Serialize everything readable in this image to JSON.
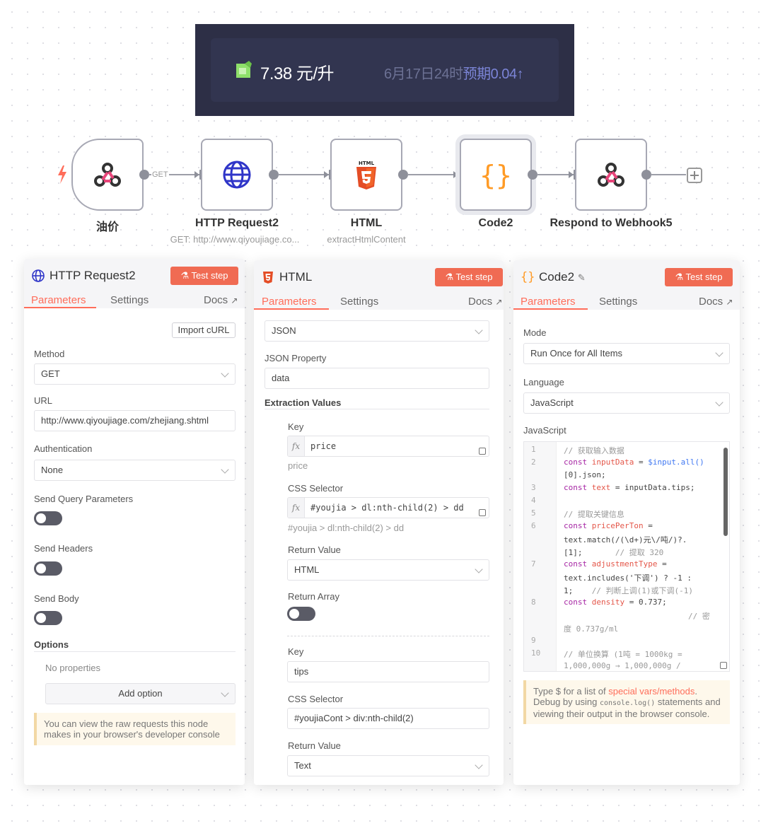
{
  "banner": {
    "price": "7.38 元/升",
    "forecast_prefix": "6月17日24时",
    "forecast_highlight": "预期0.04",
    "forecast_arrow": "↑"
  },
  "workflow": {
    "nodes": [
      {
        "label": "油价",
        "sub": ""
      },
      {
        "label": "HTTP Request2",
        "sub": "GET: http://www.qiyoujiage.co..."
      },
      {
        "label": "HTML",
        "sub": "extractHtmlContent"
      },
      {
        "label": "Code2",
        "sub": ""
      },
      {
        "label": "Respond to Webhook5",
        "sub": ""
      }
    ],
    "connection_label": "GET"
  },
  "colors": {
    "accent": "#ff6d5a",
    "banner_bg": "#2d2f46",
    "test_button": "#f06b53"
  },
  "panel_http": {
    "title": "HTTP Request2",
    "test_step": "Test step",
    "tabs": [
      "Parameters",
      "Settings"
    ],
    "docs": "Docs",
    "import_curl": "Import cURL",
    "method_label": "Method",
    "method_value": "GET",
    "url_label": "URL",
    "url_value": "http://www.qiyoujiage.com/zhejiang.shtml",
    "auth_label": "Authentication",
    "auth_value": "None",
    "send_query_label": "Send Query Parameters",
    "send_headers_label": "Send Headers",
    "send_body_label": "Send Body",
    "options_label": "Options",
    "no_properties": "No properties",
    "add_option": "Add option",
    "notice": "You can view the raw requests this node makes in your browser's developer console"
  },
  "panel_html": {
    "title": "HTML",
    "test_step": "Test step",
    "tabs": [
      "Parameters",
      "Settings"
    ],
    "docs": "Docs",
    "source_value": "JSON",
    "json_property_label": "JSON Property",
    "json_property_value": "data",
    "extraction_label": "Extraction Values",
    "item1": {
      "key_label": "Key",
      "key_value": "price",
      "key_hint": "price",
      "css_label": "CSS Selector",
      "css_value": "#youjia > dl:nth-child(2) > dd",
      "css_hint": "#youjia > dl:nth-child(2) > dd",
      "return_label": "Return Value",
      "return_value": "HTML",
      "return_array_label": "Return Array"
    },
    "item2": {
      "key_label": "Key",
      "key_value": "tips",
      "css_label": "CSS Selector",
      "css_value": "#youjiaCont > div:nth-child(2)",
      "return_label": "Return Value",
      "return_value": "Text"
    }
  },
  "panel_code": {
    "title": "Code2",
    "test_step": "Test step",
    "tabs": [
      "Parameters",
      "Settings"
    ],
    "docs": "Docs",
    "mode_label": "Mode",
    "mode_value": "Run Once for All Items",
    "language_label": "Language",
    "language_value": "JavaScript",
    "js_label": "JavaScript",
    "line_numbers": [
      "1",
      "2",
      "3",
      "4",
      "5",
      "6",
      "7",
      "8",
      "9",
      "10"
    ],
    "code": {
      "l1": "// 获取输入数据",
      "l2a_kw": "const",
      "l2a_var": "inputData",
      "l2a_rest": " = ",
      "l2a_fn": "$input.all()",
      "l2b": "[0].json;",
      "l3_kw": "const",
      "l3_var": "text",
      "l3_rest": " = inputData.tips;",
      "l5": "// 提取关键信息",
      "l6a_kw": "const",
      "l6a_var": "pricePerTon",
      "l6a_rest": " =",
      "l6b": "text.match(/(\\d+)元\\/吨/)?.",
      "l6c": "[1];",
      "l6c_cm": "// 提取 320",
      "l7a_kw": "const",
      "l7a_var": "adjustmentType",
      "l7a_rest": " =",
      "l7b": "text.includes('下调') ? -1 :",
      "l7c": "1;",
      "l7c_cm": "// 判断上调(1)或下调(-1)",
      "l8_kw": "const",
      "l8_var": "density",
      "l8_rest": " = 0.737;",
      "l8b_cm": "// 密",
      "l8c_cm": "度 0.737g/ml",
      "l10a_cm": "// 单位换算 (1吨 = 1000kg =",
      "l10b_cm": "1,000,000g → 1,000,000g /"
    },
    "hint_pre": "Type $ for a list of ",
    "hint_link": "special vars/methods",
    "hint_mid": ". Debug by using ",
    "hint_code": "console.log()",
    "hint_post": " statements and viewing their output in the browser console."
  }
}
